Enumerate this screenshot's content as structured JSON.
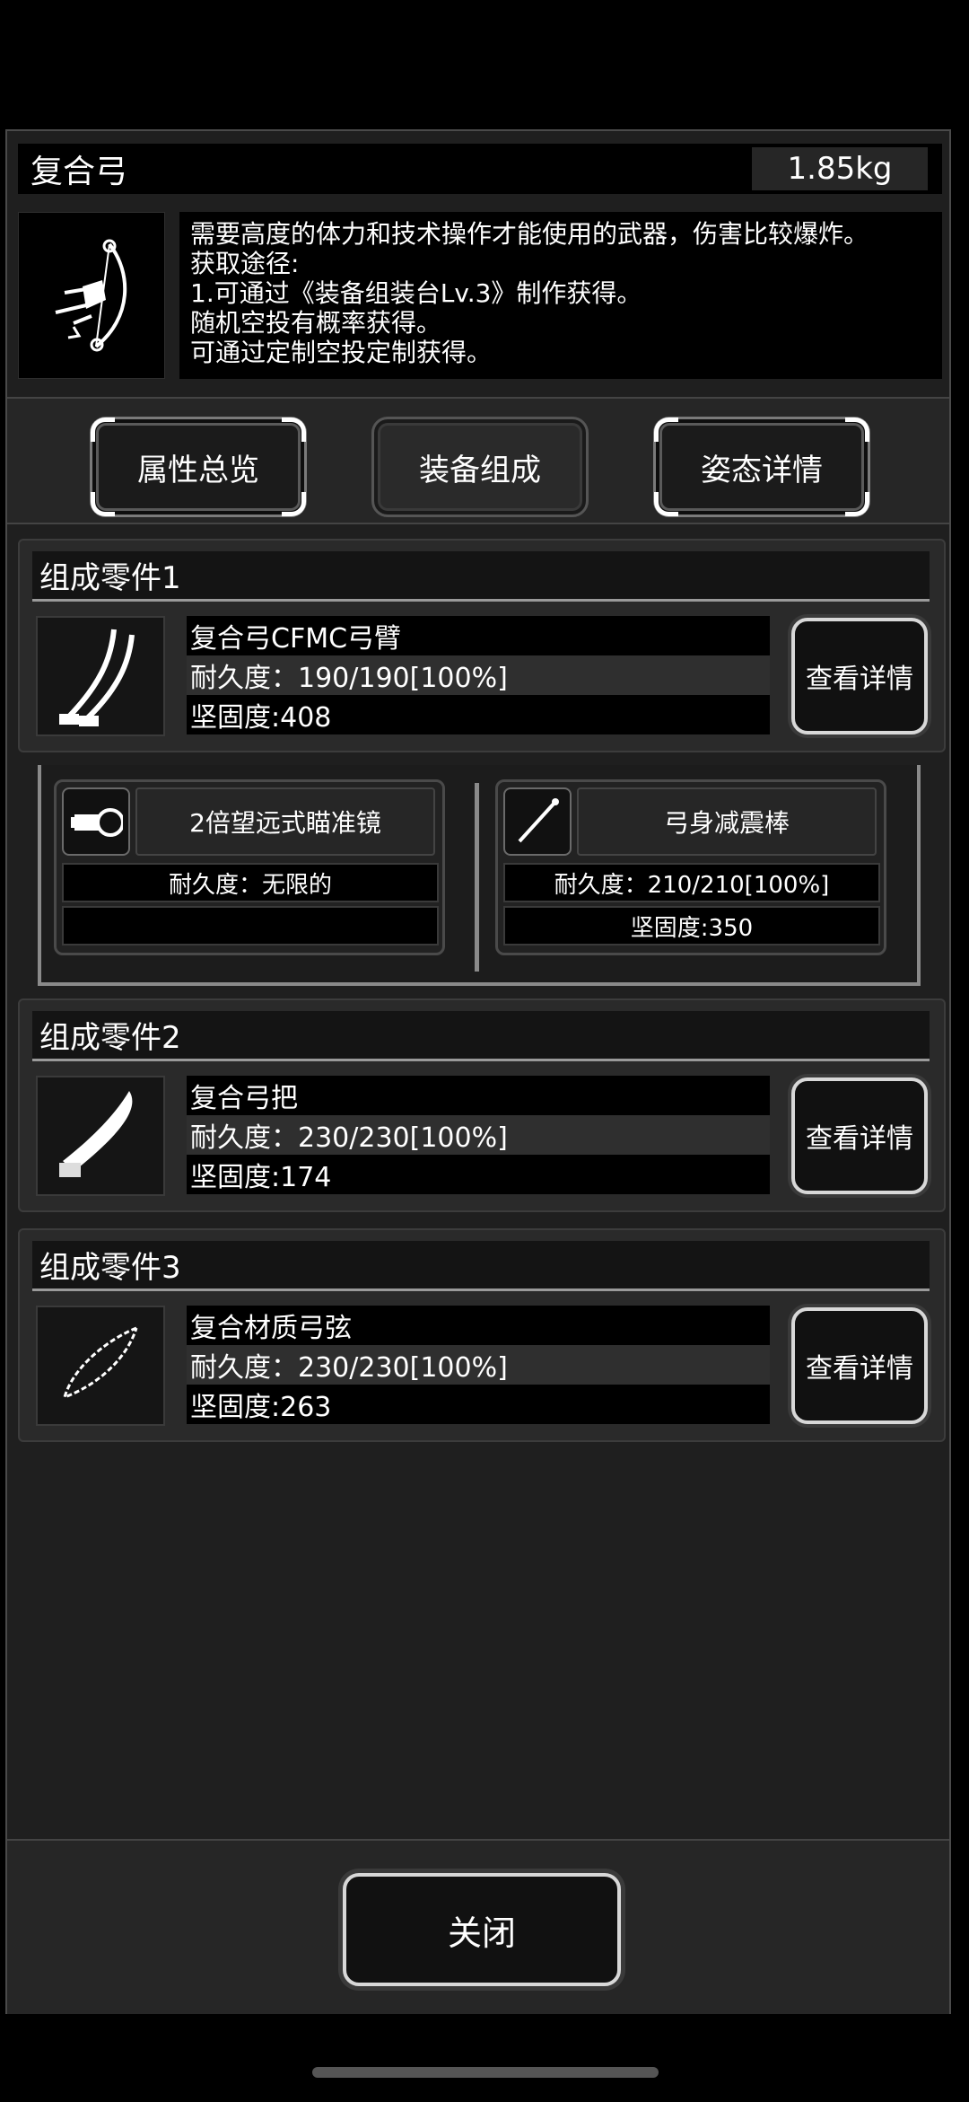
{
  "item": {
    "name": "复合弓",
    "weight": "1.85kg",
    "description": [
      "需要高度的体力和技术操作才能使用的武器，伤害比较爆炸。",
      "获取途径:",
      "1.可通过《装备组装台Lv.3》制作获得。",
      "随机空投有概率获得。",
      "可通过定制空投定制获得。"
    ]
  },
  "tabs": [
    {
      "label": "属性总览"
    },
    {
      "label": "装备组成"
    },
    {
      "label": "姿态详情"
    }
  ],
  "parts": [
    {
      "header": "组成零件1",
      "name": "复合弓CFMC弓臂",
      "durability": "耐久度：190/190[100%]",
      "toughness": "坚固度:408",
      "button": "查看详情"
    },
    {
      "header": "组成零件2",
      "name": "复合弓把",
      "durability": "耐久度：230/230[100%]",
      "toughness": "坚固度:174",
      "button": "查看详情"
    },
    {
      "header": "组成零件3",
      "name": "复合材质弓弦",
      "durability": "耐久度：230/230[100%]",
      "toughness": "坚固度:263",
      "button": "查看详情"
    }
  ],
  "accessories": [
    {
      "name": "2倍望远式瞄准镜",
      "durability": "耐久度：无限的",
      "toughness": ""
    },
    {
      "name": "弓身减震棒",
      "durability": "耐久度：210/210[100%]",
      "toughness": "坚固度:350"
    }
  ],
  "footer": {
    "close_label": "关闭"
  }
}
